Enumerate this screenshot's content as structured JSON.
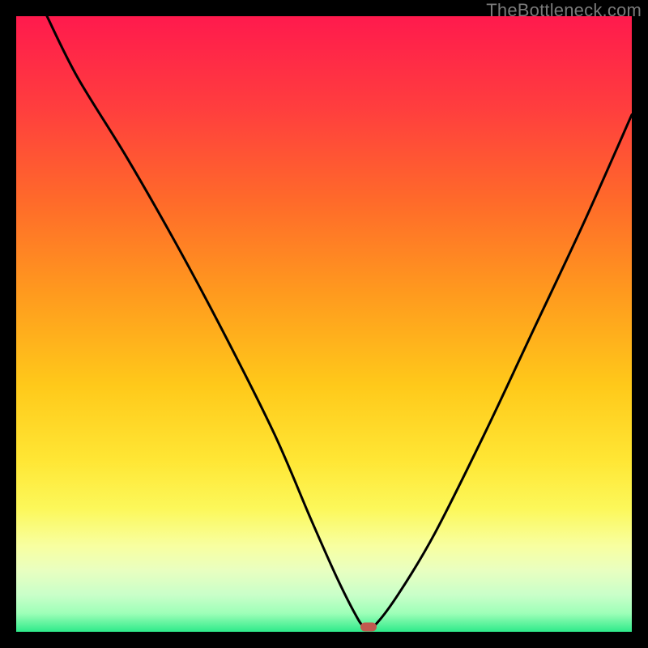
{
  "watermark": "TheBottleneck.com",
  "chart_data": {
    "type": "line",
    "title": "",
    "xlabel": "",
    "ylabel": "",
    "xlim": [
      0,
      100
    ],
    "ylim": [
      0,
      100
    ],
    "curve": {
      "name": "bottleneck-curve",
      "x": [
        5,
        10,
        18,
        26,
        34,
        42,
        48,
        52,
        55,
        56.5,
        58,
        62,
        68,
        76,
        84,
        92,
        100
      ],
      "y": [
        100,
        90,
        77,
        63,
        48,
        32,
        18,
        9,
        3,
        0.8,
        0.8,
        6,
        16,
        32,
        49,
        66,
        84
      ]
    },
    "marker": {
      "x": 57.2,
      "y": 0.8
    },
    "background_gradient_note": "vertical red→orange→yellow→green mapping to bottleneck severity"
  }
}
